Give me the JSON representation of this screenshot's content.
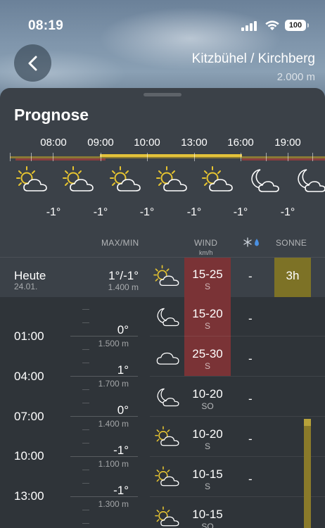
{
  "status_bar": {
    "time": "08:19",
    "battery": "100"
  },
  "header": {
    "location": "Kitzbühel / Kirchberg",
    "altitude": "2.000 m"
  },
  "forecast": {
    "title": "Prognose",
    "timeline_hours": [
      "08:00",
      "09:00",
      "10:00",
      "13:00",
      "16:00",
      "19:00"
    ],
    "timeline_icons": [
      "sun-cloud-icon",
      "sun-cloud-icon",
      "sun-cloud-icon",
      "sun-cloud-icon",
      "sun-cloud-icon",
      "moon-cloud-icon",
      "moon-cloud-icon"
    ],
    "timeline_temps": [
      "-1°",
      "-1°",
      "-1°",
      "-1°",
      "-1°",
      "-1°"
    ]
  },
  "columns": {
    "max_min": "MAX/MIN",
    "wind": "WIND",
    "wind_unit": "km/h",
    "sonne": "SONNE"
  },
  "today": {
    "label": "Heute",
    "date": "24.01.",
    "temp": "1°/-1°",
    "height": "1.400 m",
    "icon": "sun-cloud-icon",
    "wind": "15-25",
    "wind_dir": "S",
    "precip": "-",
    "sun": "3h"
  },
  "time_labels": [
    "01:00",
    "04:00",
    "07:00",
    "10:00",
    "13:00"
  ],
  "temps": [
    {
      "temp": "0°",
      "height": "1.500 m"
    },
    {
      "temp": "1°",
      "height": "1.700 m"
    },
    {
      "temp": "0°",
      "height": "1.400 m"
    },
    {
      "temp": "-1°",
      "height": "1.100 m"
    },
    {
      "temp": "-1°",
      "height": "1.300 m"
    }
  ],
  "hour_rows": [
    {
      "icon": "moon-cloud-icon",
      "wind": "15-20",
      "dir": "S",
      "precip": "-"
    },
    {
      "icon": "cloud-icon",
      "wind": "25-30",
      "dir": "S",
      "precip": "-"
    },
    {
      "icon": "moon-cloud-icon",
      "wind": "10-20",
      "dir": "SO",
      "precip": "-"
    },
    {
      "icon": "sun-cloud-icon",
      "wind": "10-20",
      "dir": "S",
      "precip": "-"
    },
    {
      "icon": "sun-cloud-icon",
      "wind": "10-15",
      "dir": "S",
      "precip": "-"
    },
    {
      "icon": "sun-cloud-icon",
      "wind": "10-15",
      "dir": "SO",
      "precip": "-"
    }
  ],
  "colors": {
    "sun_yellow": "#e3c23a",
    "wind_red": "#7a3336",
    "sun_badge": "#7d7226"
  }
}
